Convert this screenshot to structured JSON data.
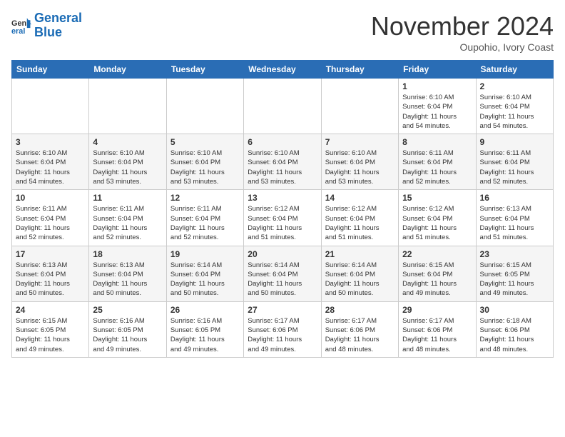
{
  "header": {
    "logo_line1": "General",
    "logo_line2": "Blue",
    "month": "November 2024",
    "location": "Oupohio, Ivory Coast"
  },
  "weekdays": [
    "Sunday",
    "Monday",
    "Tuesday",
    "Wednesday",
    "Thursday",
    "Friday",
    "Saturday"
  ],
  "weeks": [
    [
      {
        "day": "",
        "info": ""
      },
      {
        "day": "",
        "info": ""
      },
      {
        "day": "",
        "info": ""
      },
      {
        "day": "",
        "info": ""
      },
      {
        "day": "",
        "info": ""
      },
      {
        "day": "1",
        "info": "Sunrise: 6:10 AM\nSunset: 6:04 PM\nDaylight: 11 hours\nand 54 minutes."
      },
      {
        "day": "2",
        "info": "Sunrise: 6:10 AM\nSunset: 6:04 PM\nDaylight: 11 hours\nand 54 minutes."
      }
    ],
    [
      {
        "day": "3",
        "info": "Sunrise: 6:10 AM\nSunset: 6:04 PM\nDaylight: 11 hours\nand 54 minutes."
      },
      {
        "day": "4",
        "info": "Sunrise: 6:10 AM\nSunset: 6:04 PM\nDaylight: 11 hours\nand 53 minutes."
      },
      {
        "day": "5",
        "info": "Sunrise: 6:10 AM\nSunset: 6:04 PM\nDaylight: 11 hours\nand 53 minutes."
      },
      {
        "day": "6",
        "info": "Sunrise: 6:10 AM\nSunset: 6:04 PM\nDaylight: 11 hours\nand 53 minutes."
      },
      {
        "day": "7",
        "info": "Sunrise: 6:10 AM\nSunset: 6:04 PM\nDaylight: 11 hours\nand 53 minutes."
      },
      {
        "day": "8",
        "info": "Sunrise: 6:11 AM\nSunset: 6:04 PM\nDaylight: 11 hours\nand 52 minutes."
      },
      {
        "day": "9",
        "info": "Sunrise: 6:11 AM\nSunset: 6:04 PM\nDaylight: 11 hours\nand 52 minutes."
      }
    ],
    [
      {
        "day": "10",
        "info": "Sunrise: 6:11 AM\nSunset: 6:04 PM\nDaylight: 11 hours\nand 52 minutes."
      },
      {
        "day": "11",
        "info": "Sunrise: 6:11 AM\nSunset: 6:04 PM\nDaylight: 11 hours\nand 52 minutes."
      },
      {
        "day": "12",
        "info": "Sunrise: 6:11 AM\nSunset: 6:04 PM\nDaylight: 11 hours\nand 52 minutes."
      },
      {
        "day": "13",
        "info": "Sunrise: 6:12 AM\nSunset: 6:04 PM\nDaylight: 11 hours\nand 51 minutes."
      },
      {
        "day": "14",
        "info": "Sunrise: 6:12 AM\nSunset: 6:04 PM\nDaylight: 11 hours\nand 51 minutes."
      },
      {
        "day": "15",
        "info": "Sunrise: 6:12 AM\nSunset: 6:04 PM\nDaylight: 11 hours\nand 51 minutes."
      },
      {
        "day": "16",
        "info": "Sunrise: 6:13 AM\nSunset: 6:04 PM\nDaylight: 11 hours\nand 51 minutes."
      }
    ],
    [
      {
        "day": "17",
        "info": "Sunrise: 6:13 AM\nSunset: 6:04 PM\nDaylight: 11 hours\nand 50 minutes."
      },
      {
        "day": "18",
        "info": "Sunrise: 6:13 AM\nSunset: 6:04 PM\nDaylight: 11 hours\nand 50 minutes."
      },
      {
        "day": "19",
        "info": "Sunrise: 6:14 AM\nSunset: 6:04 PM\nDaylight: 11 hours\nand 50 minutes."
      },
      {
        "day": "20",
        "info": "Sunrise: 6:14 AM\nSunset: 6:04 PM\nDaylight: 11 hours\nand 50 minutes."
      },
      {
        "day": "21",
        "info": "Sunrise: 6:14 AM\nSunset: 6:04 PM\nDaylight: 11 hours\nand 50 minutes."
      },
      {
        "day": "22",
        "info": "Sunrise: 6:15 AM\nSunset: 6:04 PM\nDaylight: 11 hours\nand 49 minutes."
      },
      {
        "day": "23",
        "info": "Sunrise: 6:15 AM\nSunset: 6:05 PM\nDaylight: 11 hours\nand 49 minutes."
      }
    ],
    [
      {
        "day": "24",
        "info": "Sunrise: 6:15 AM\nSunset: 6:05 PM\nDaylight: 11 hours\nand 49 minutes."
      },
      {
        "day": "25",
        "info": "Sunrise: 6:16 AM\nSunset: 6:05 PM\nDaylight: 11 hours\nand 49 minutes."
      },
      {
        "day": "26",
        "info": "Sunrise: 6:16 AM\nSunset: 6:05 PM\nDaylight: 11 hours\nand 49 minutes."
      },
      {
        "day": "27",
        "info": "Sunrise: 6:17 AM\nSunset: 6:06 PM\nDaylight: 11 hours\nand 49 minutes."
      },
      {
        "day": "28",
        "info": "Sunrise: 6:17 AM\nSunset: 6:06 PM\nDaylight: 11 hours\nand 48 minutes."
      },
      {
        "day": "29",
        "info": "Sunrise: 6:17 AM\nSunset: 6:06 PM\nDaylight: 11 hours\nand 48 minutes."
      },
      {
        "day": "30",
        "info": "Sunrise: 6:18 AM\nSunset: 6:06 PM\nDaylight: 11 hours\nand 48 minutes."
      }
    ]
  ]
}
